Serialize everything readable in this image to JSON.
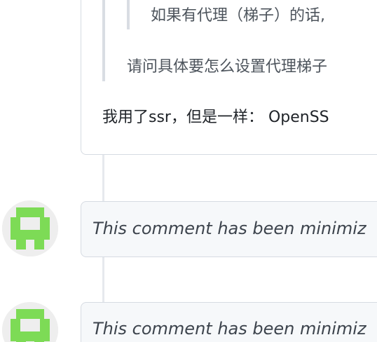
{
  "comment": {
    "nested_quote": "如果有代理（梯子）的话,",
    "quote": "请问具体要怎么设置代理梯子",
    "body": "我用了ssr，但是一样： OpenSS"
  },
  "minimized_comments": [
    {
      "label": "This comment has been minimiz"
    },
    {
      "label": "This comment has been minimiz"
    }
  ],
  "colors": {
    "avatar_green": "#7ddb56",
    "avatar_bg": "#eeeeee",
    "card_border": "#d6dbe2",
    "minimized_bg": "#f6f8fa"
  }
}
